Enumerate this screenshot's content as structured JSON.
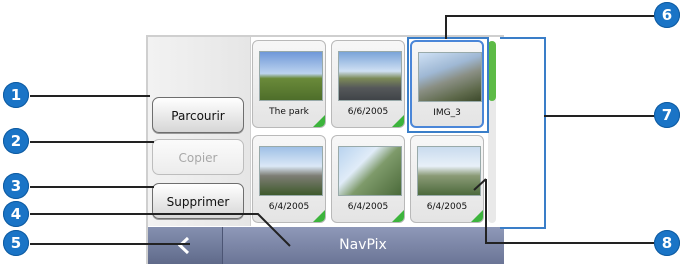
{
  "side_buttons": {
    "browse": "Parcourir",
    "copy": "Copier",
    "delete": "Supprimer"
  },
  "thumbnails": [
    {
      "caption": "The park"
    },
    {
      "caption": "6/6/2005"
    },
    {
      "caption": "IMG_3"
    },
    {
      "caption": "6/4/2005"
    },
    {
      "caption": "6/4/2005"
    },
    {
      "caption": "6/4/2005"
    }
  ],
  "title_bar": {
    "title": "NavPix"
  },
  "callouts": [
    "1",
    "2",
    "3",
    "4",
    "5",
    "6",
    "7",
    "8"
  ],
  "colors": {
    "callout_blue": "#1a74c6",
    "accent_green": "#5dbb46",
    "titlebar": "#7a84a4"
  }
}
